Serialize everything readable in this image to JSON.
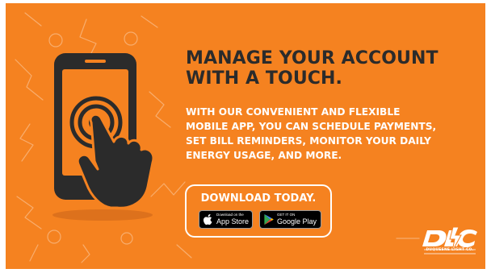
{
  "headline": {
    "line1": "MANAGE YOUR ACCOUNT",
    "line2": "WITH A TOUCH."
  },
  "body": {
    "line1": "WITH OUR CONVENIENT AND FLEXIBLE",
    "line2": "MOBILE APP, YOU CAN SCHEDULE PAYMENTS,",
    "line3": "SET BILL REMINDERS, MONITOR YOUR DAILY",
    "line4": "ENERGY USAGE, AND MORE."
  },
  "download": {
    "title": "DOWNLOAD TODAY.",
    "app_store": {
      "small": "Download on the",
      "big": "App Store",
      "icon": "apple-icon"
    },
    "google_play": {
      "small": "GET IT ON",
      "big": "Google Play",
      "icon": "google-play-icon"
    }
  },
  "logo": {
    "name": "DUQUESNE LIGHT CO.",
    "icon": "dlc-logo"
  },
  "colors": {
    "background": "#f58220",
    "headline": "#2b2b2b",
    "text": "#ffffff",
    "badge": "#000000"
  }
}
